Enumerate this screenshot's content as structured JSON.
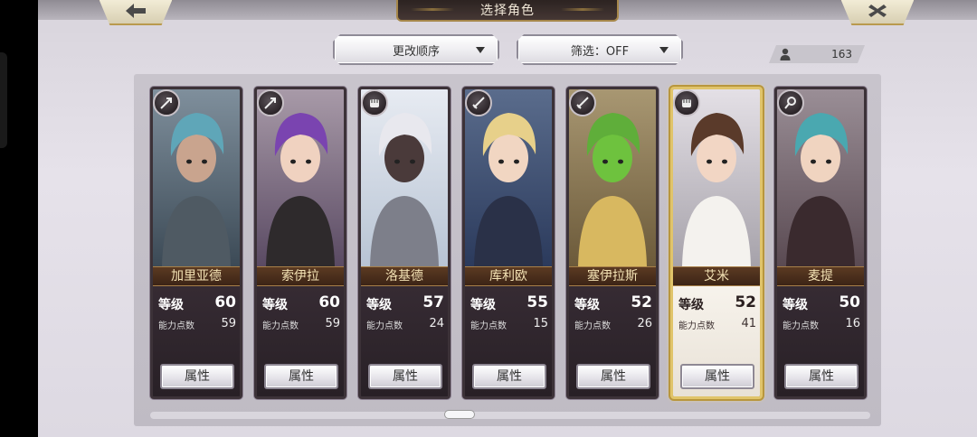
{
  "header": {
    "title": "选择角色"
  },
  "toolbar": {
    "sort_label": "更改顺序",
    "filter_label": "筛选：OFF"
  },
  "roster": {
    "count": "163"
  },
  "labels": {
    "level": "等级",
    "ability_points": "能力点数",
    "attribute_button": "属性"
  },
  "colors": {
    "selected_border": "#e0c46a",
    "name_bar": "#5b3a22"
  },
  "characters": [
    {
      "name": "加里亚德",
      "level": "60",
      "points": "59",
      "class_icon": "arrow-icon",
      "selected": false
    },
    {
      "name": "索伊拉",
      "level": "60",
      "points": "59",
      "class_icon": "arrow-icon",
      "selected": false
    },
    {
      "name": "洛基德",
      "level": "57",
      "points": "24",
      "class_icon": "fist-icon",
      "selected": false
    },
    {
      "name": "库利欧",
      "level": "55",
      "points": "15",
      "class_icon": "sword-icon",
      "selected": false
    },
    {
      "name": "塞伊拉斯",
      "level": "52",
      "points": "26",
      "class_icon": "sword-icon",
      "selected": false
    },
    {
      "name": "艾米",
      "level": "52",
      "points": "41",
      "class_icon": "fist-icon",
      "selected": true
    },
    {
      "name": "麦提",
      "level": "50",
      "points": "16",
      "class_icon": "staff-icon",
      "selected": false
    }
  ]
}
